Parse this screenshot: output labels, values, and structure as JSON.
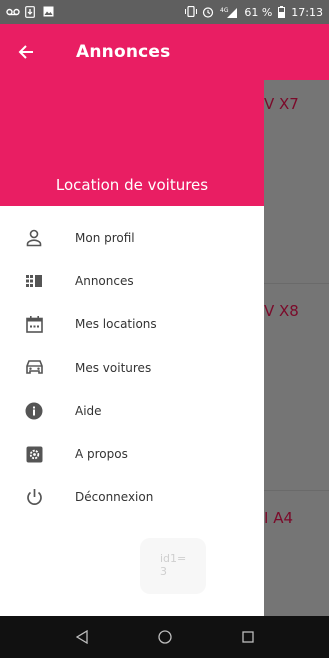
{
  "status_bar": {
    "battery": "61 %",
    "time": "17:13",
    "network": "4G"
  },
  "app_bar": {
    "title": "Annonces"
  },
  "drawer": {
    "header_title": "Location de voitures",
    "items": [
      {
        "label": "Mon profil",
        "icon": "person-icon"
      },
      {
        "label": "Annonces",
        "icon": "list-icon"
      },
      {
        "label": "Mes locations",
        "icon": "calendar-icon"
      },
      {
        "label": "Mes voitures",
        "icon": "car-icon"
      },
      {
        "label": "Aide",
        "icon": "info-icon"
      },
      {
        "label": "A propos",
        "icon": "settings-icon"
      },
      {
        "label": "Déconnexion",
        "icon": "power-icon"
      }
    ],
    "badge_line1": "id1=",
    "badge_line2": "3"
  },
  "main": {
    "cards": [
      {
        "title": "V X7"
      },
      {
        "title": "V X8"
      },
      {
        "title": "I A4"
      }
    ]
  },
  "colors": {
    "primary": "#e91e63",
    "car_title": "#7b0a2a"
  }
}
